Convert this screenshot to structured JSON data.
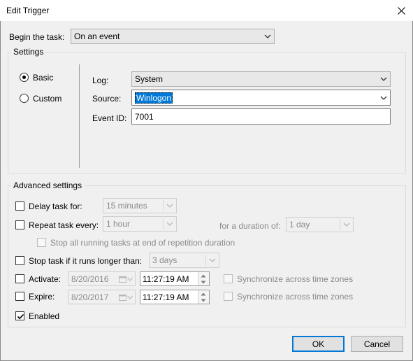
{
  "window": {
    "title": "Edit Trigger"
  },
  "begin_task": {
    "label": "Begin the task:",
    "value": "On an event"
  },
  "settings": {
    "title": "Settings",
    "radios": [
      {
        "label": "Basic",
        "selected": true
      },
      {
        "label": "Custom",
        "selected": false
      }
    ],
    "log": {
      "label": "Log:",
      "value": "System"
    },
    "source": {
      "label": "Source:",
      "value": "Winlogon"
    },
    "event_id": {
      "label": "Event ID:",
      "value": "7001"
    }
  },
  "advanced": {
    "title": "Advanced settings",
    "delay": {
      "label": "Delay task for:",
      "value": "15 minutes",
      "checked": false
    },
    "repeat": {
      "label": "Repeat task every:",
      "value": "1 hour",
      "checked": false,
      "duration_label": "for a duration of:",
      "duration_value": "1 day"
    },
    "stop_all": {
      "label": "Stop all running tasks at end of repetition duration",
      "checked": false
    },
    "stop_if_longer": {
      "label": "Stop task if it runs longer than:",
      "value": "3 days",
      "checked": false
    },
    "activate": {
      "label": "Activate:",
      "date": "8/20/2016",
      "time": "11:27:19 AM",
      "checked": false,
      "sync_label": "Synchronize across time zones"
    },
    "expire": {
      "label": "Expire:",
      "date": "8/20/2017",
      "time": "11:27:19 AM",
      "checked": false,
      "sync_label": "Synchronize across time zones"
    },
    "enabled": {
      "label": "Enabled",
      "checked": true
    }
  },
  "buttons": {
    "ok": "OK",
    "cancel": "Cancel"
  },
  "colors": {
    "accent": "#0078d7",
    "window_bg": "#f0f0f0",
    "disabled_text": "#8a8a8a"
  }
}
